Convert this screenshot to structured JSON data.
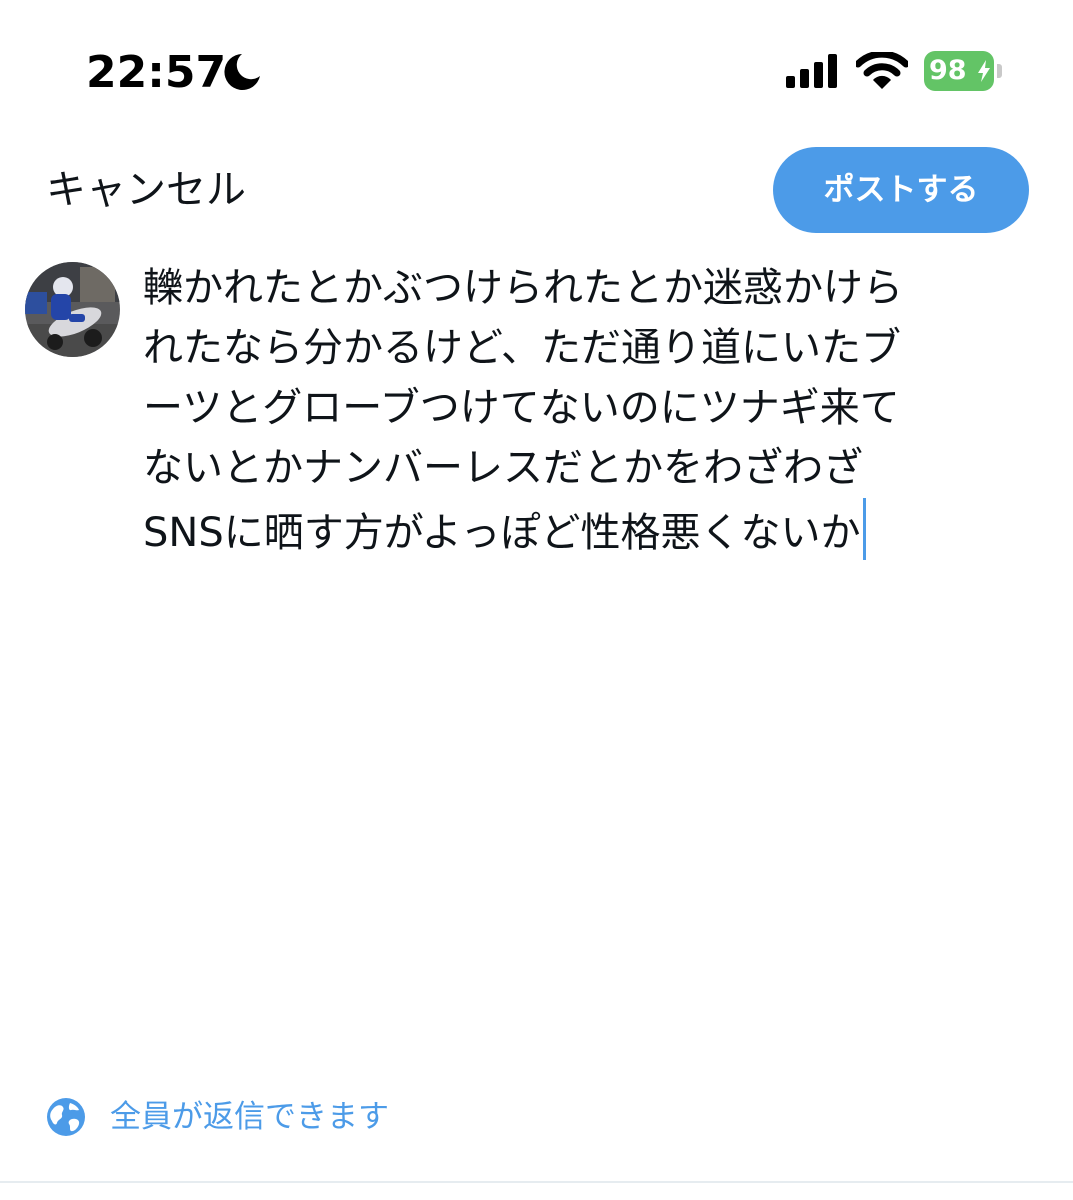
{
  "status_bar": {
    "time": "22:57",
    "battery_level": "98",
    "icons": [
      "moon-icon",
      "signal-icon",
      "wifi-icon",
      "bolt-icon"
    ]
  },
  "compose_header": {
    "cancel_label": "キャンセル",
    "post_label": "ポストする"
  },
  "composer": {
    "text_lines": [
      "轢かれたとかぶつけられたとか迷惑かけら",
      "れたなら分かるけど、ただ通り道にいたブ",
      "ーツとグローブつけてないのにツナギ来て",
      "ないとかナンバーレスだとかをわざわざ",
      "SNSに晒す方がよっぽど性格悪くないか"
    ]
  },
  "reply_setting": {
    "icon": "globe-icon",
    "label": "全員が返信できます"
  },
  "colors": {
    "accent": "#4c9be8",
    "battery": "#63c466",
    "text": "#0f1419"
  }
}
